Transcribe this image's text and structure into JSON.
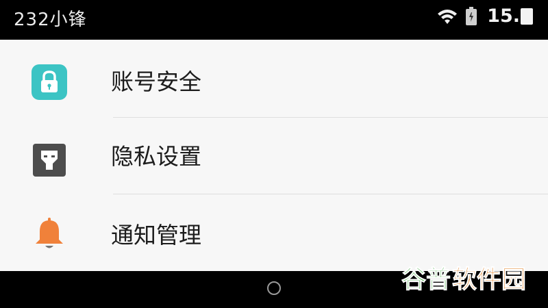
{
  "status_bar": {
    "carrier": "232小锋",
    "time": "15.",
    "icons": [
      "wifi-icon",
      "battery-icon"
    ]
  },
  "settings": {
    "items": [
      {
        "label": "账号安全",
        "icon": "lock-icon",
        "icon_color": "#3cc4c4"
      },
      {
        "label": "隐私设置",
        "icon": "privacy-shield-icon",
        "icon_color": "#4d4d4d"
      },
      {
        "label": "通知管理",
        "icon": "bell-icon",
        "icon_color": "#f0813a"
      }
    ]
  },
  "nav_bar": {
    "icons": [
      "home-circle-icon"
    ]
  },
  "watermark": {
    "text": "谷普软件园",
    "colors": [
      "#3aa63a",
      "#e07a1a"
    ]
  }
}
